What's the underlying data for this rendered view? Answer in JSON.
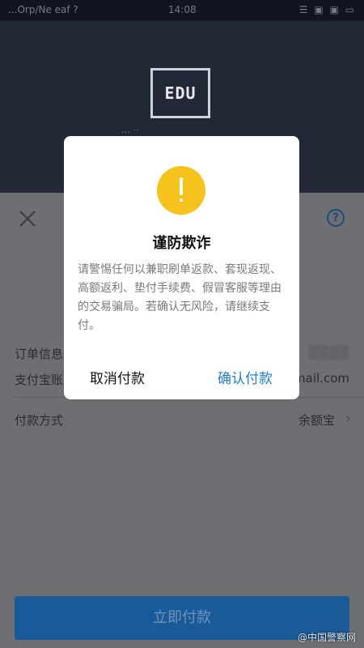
{
  "status_bar": {
    "carrier": "...Orp/Ne eaf ?",
    "time": "14:08",
    "icons": "☰ ▣ ▣ ▭"
  },
  "header": {
    "logo_text": "EDU",
    "subtitle": "… ··"
  },
  "icons": {
    "close": "close-icon",
    "help": "help-icon",
    "warning": "warning-icon",
    "chevron": "chevron-right-icon"
  },
  "help_glyph": "?",
  "rows": {
    "order_info": {
      "label": "订单信息",
      "value": "▒▒▒▒"
    },
    "alipay_account": {
      "label": "支付宝账",
      "value": "mail.com"
    },
    "payment_method": {
      "label": "付款方式",
      "value": "余额宝",
      "chevron": "›"
    }
  },
  "pay_button": {
    "label": "立即付款"
  },
  "dialog": {
    "title": "谨防欺诈",
    "message": "请警惕任何以兼职刷单返款、套现返现、高额返利、垫付手续费、假冒客服等理由的交易骗局。若确认无风险，请继续支付。",
    "cancel_label": "取消付款",
    "confirm_label": "确认付款"
  },
  "watermark": "@中国警察网",
  "colors": {
    "accent": "#1d7fd6",
    "warning": "#f6c21c",
    "pay_button": "#1a5a99",
    "overlay": "#6e6f73"
  }
}
